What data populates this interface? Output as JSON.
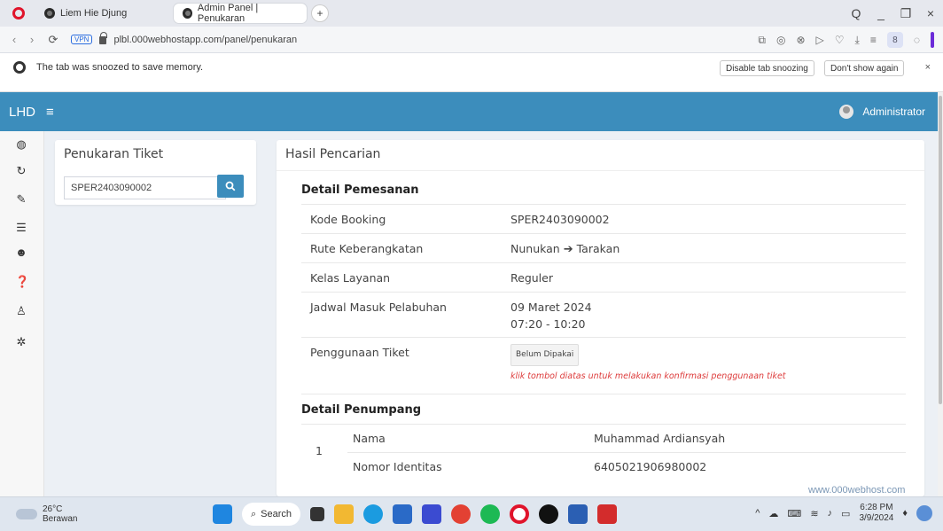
{
  "browser": {
    "tabs": [
      {
        "label": "Liem Hie Djung",
        "active": false
      },
      {
        "label": "Admin Panel | Penukaran",
        "active": true
      }
    ],
    "new_tab_label": "+",
    "url": "plbl.000webhostapp.com/panel/penukaran",
    "vpn_label": "VPN",
    "profile_label": "8",
    "snooze": {
      "message": "The tab was snoozed to save memory.",
      "disable_label": "Disable tab snoozing",
      "dont_show_label": "Don't show again",
      "close_label": "×"
    },
    "window_controls": {
      "search": "Q",
      "minimize": "_",
      "restore": "❐",
      "close": "×"
    }
  },
  "app": {
    "brand": "LHD",
    "menu_icon": "≡",
    "user_name": "Administrator",
    "accent_color": "#3c8dbc"
  },
  "sidebar": {
    "icons": [
      "dashboard-icon",
      "refresh-icon",
      "ticket-icon",
      "database-icon",
      "users-icon",
      "help-icon",
      "captain-icon",
      "settings-icon"
    ]
  },
  "left_panel": {
    "title": "Penukaran Tiket",
    "search_value": "SPER2403090002"
  },
  "result_panel": {
    "title": "Hasil Pencarian",
    "booking_section": "Detail Pemesanan",
    "rows": [
      {
        "label": "Kode Booking",
        "value": "SPER2403090002"
      },
      {
        "label": "Rute Keberangkatan",
        "from": "Nunukan",
        "to": "Tarakan"
      },
      {
        "label": "Kelas Layanan",
        "value": "Reguler"
      },
      {
        "label": "Jadwal Masuk Pelabuhan",
        "date": "09 Maret 2024",
        "time": "07:20 - 10:20"
      },
      {
        "label": "Penggunaan Tiket",
        "badge": "Belum Dipakai",
        "note": "klik tombol diatas untuk melakukan konfirmasi penggunaan tiket"
      }
    ],
    "passenger_section": "Detail Penumpang",
    "passenger": {
      "number": "1",
      "name_label": "Nama",
      "name_value": "Muhammad Ardiansyah",
      "id_label": "Nomor Identitas",
      "id_value": "6405021906980002"
    }
  },
  "watermark": "www.000webhost.com",
  "taskbar": {
    "temp": "26°C",
    "condition": "Berawan",
    "search_label": "Search",
    "time": "6:28 PM",
    "date": "3/9/2024"
  }
}
